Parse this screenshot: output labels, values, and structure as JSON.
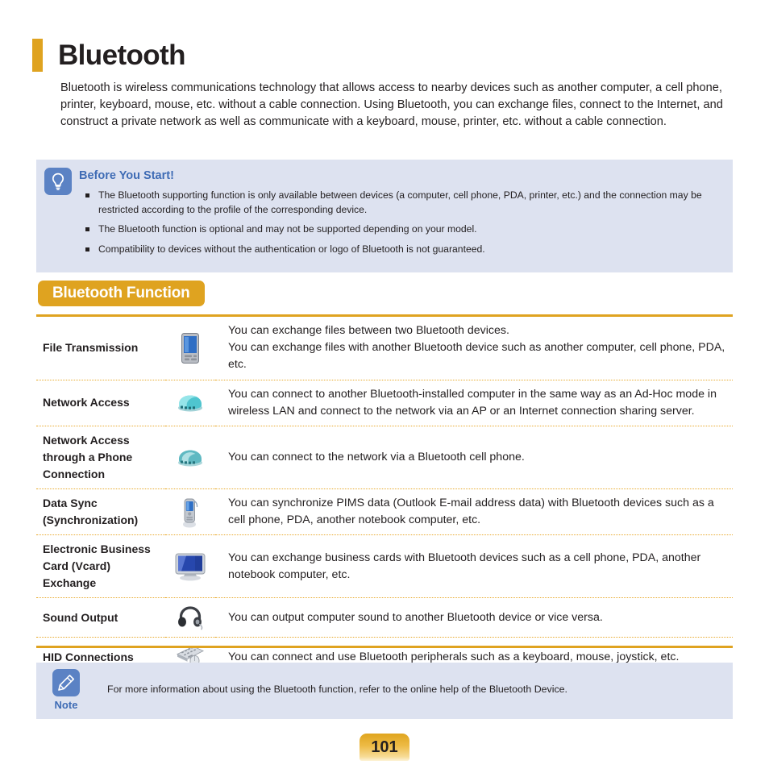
{
  "page": {
    "title": "Bluetooth",
    "intro": "Bluetooth is wireless communications technology that allows access to nearby devices such as another computer, a cell phone, printer, keyboard, mouse, etc. without a cable connection. Using Bluetooth, you can exchange files, connect to the Internet, and construct a private network as well as communicate with a keyboard, mouse, printer, etc. without a cable connection.",
    "page_number": "101"
  },
  "notice": {
    "icon": "lightbulb-icon",
    "heading": "Before You Start!",
    "items": [
      "The Bluetooth supporting function is only available between devices (a computer, cell phone, PDA, printer, etc.) and the connection may be restricted according to the profile of the corresponding device.",
      "The Bluetooth function is optional and may not be supported depending on your model.",
      "Compatibility to devices without the authentication or logo of Bluetooth is not guaranteed."
    ]
  },
  "section": {
    "heading": "Bluetooth Function"
  },
  "table": {
    "rows": [
      {
        "name": "File Transmission",
        "icon": "pda-device-icon",
        "description": "You can exchange files between two Bluetooth devices.\nYou can exchange files with another Bluetooth device such as another computer, cell phone, PDA, etc."
      },
      {
        "name": "Network Access",
        "icon": "network-modem-icon",
        "description": "You can connect to another Bluetooth-installed computer in the same way as an Ad-Hoc mode in wireless LAN and connect to the network via an AP or an Internet connection sharing server."
      },
      {
        "name": "Network Access through a Phone Connection",
        "icon": "network-modem-icon",
        "description": "You can connect to the network via a Bluetooth cell phone."
      },
      {
        "name": "Data Sync (Synchronization)",
        "icon": "cellphone-sync-icon",
        "description": "You can synchronize PIMS data (Outlook E-mail address data) with Bluetooth devices such as a cell phone, PDA, another notebook computer, etc."
      },
      {
        "name": "Electronic Business Card (Vcard) Exchange",
        "icon": "monitor-icon",
        "description": "You can exchange business cards with Bluetooth devices such as a cell phone, PDA, another notebook computer, etc."
      },
      {
        "name": "Sound Output",
        "icon": "headphones-icon",
        "description": "You can output computer sound to another Bluetooth device or vice versa."
      },
      {
        "name": "HID Connections",
        "icon": "keyboard-mouse-icon",
        "description": "You can connect and use Bluetooth peripherals such as a keyboard, mouse, joystick, etc."
      }
    ]
  },
  "note": {
    "icon": "pencil-icon",
    "label": "Note",
    "text": "For more information about using the Bluetooth function, refer to the online help of the Bluetooth Device."
  },
  "colors": {
    "accent_gold": "#dfa320",
    "notice_bg": "#dde2f0",
    "notice_blue": "#3f6cb5",
    "icon_badge_blue": "#5b82c4",
    "text": "#231f20"
  }
}
